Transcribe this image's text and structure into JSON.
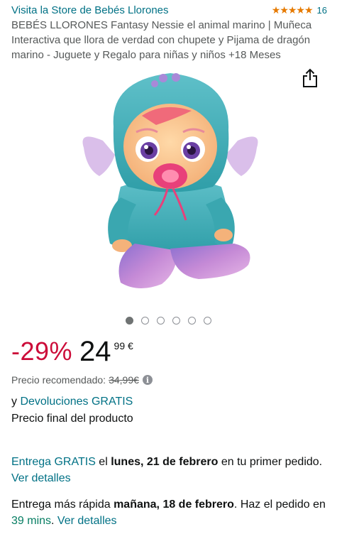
{
  "header": {
    "store_link": "Visita la Store de Bebés Llorones",
    "rating_stars": "★★★★★",
    "rating_count": "16"
  },
  "product": {
    "title": "BEBÉS LLORONES Fantasy Nessie el animal marino | Muñeca Interactiva que llora de verdad con chupete y Pijama de dragón marino - Juguete y Regalo para niñas y niños +18 Meses",
    "image_count": 6,
    "active_image_index": 0
  },
  "price": {
    "discount": "-29%",
    "whole": "24",
    "fraction": "99 €",
    "rrp_label": "Precio recomendado:",
    "rrp_value": "34,99€",
    "info_icon": "i"
  },
  "returns": {
    "prefix": "y ",
    "link": "Devoluciones GRATIS",
    "final_price": "Precio final del producto"
  },
  "delivery": {
    "free_link": "Entrega GRATIS",
    "text1": " el ",
    "date": "lunes, 21 de febrero",
    "text2": " en tu primer pedido. ",
    "details_link": "Ver detalles"
  },
  "fast_delivery": {
    "text1": "Entrega más rápida ",
    "date": "mañana, 18 de febrero",
    "text2": ". Haz el pedido en ",
    "countdown": "39 mins",
    "text3": ". ",
    "details_link": "Ver detalles"
  },
  "colors": {
    "link": "#007185",
    "discount": "#cc0c39",
    "stars": "#e67a00",
    "countdown": "#067d62"
  },
  "icons": {
    "share": "share-icon",
    "info": "info-icon"
  }
}
